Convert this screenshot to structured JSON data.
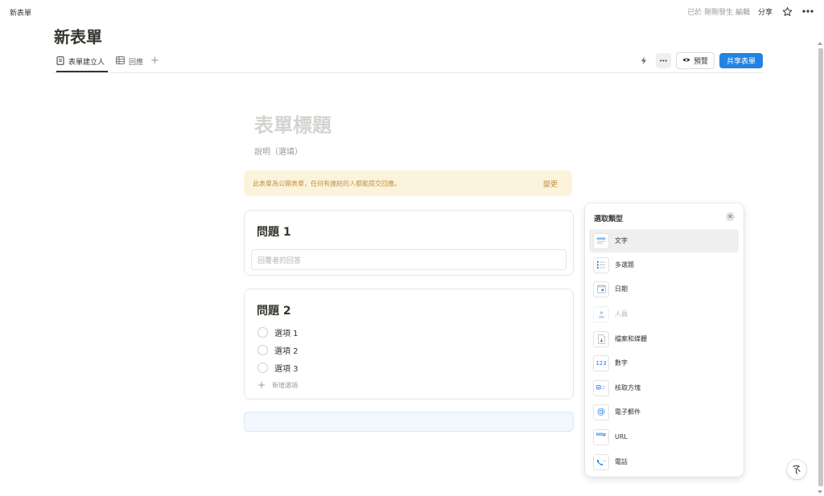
{
  "breadcrumb": "新表單",
  "topbar": {
    "edited": "已於 剛剛發生 編輯",
    "share": "分享"
  },
  "page_title": "新表單",
  "tabs": [
    {
      "label": "表單建立人",
      "icon": "form-icon"
    },
    {
      "label": "回應",
      "icon": "table-icon"
    }
  ],
  "toolbar": {
    "preview": "預覽",
    "share_form": "共享表單"
  },
  "form": {
    "title_placeholder": "表單標題",
    "desc_placeholder": "說明（選填）",
    "notice": "此表單為公開表單，任何有連結的人都能提交回應。",
    "notice_action": "變更",
    "questions": [
      {
        "title": "問題 1",
        "answer_placeholder": "回覆者的回答"
      },
      {
        "title": "問題 2",
        "options": [
          "選項 1",
          "選項 2",
          "選項 3"
        ],
        "add_option": "新增選項"
      }
    ]
  },
  "type_panel": {
    "title": "選取類型",
    "items": [
      {
        "label": "文字",
        "icon": "text-type-icon",
        "selected": true
      },
      {
        "label": "多選題",
        "icon": "multi-select-icon"
      },
      {
        "label": "日期",
        "icon": "date-icon"
      },
      {
        "label": "人員",
        "icon": "person-icon",
        "disabled": true
      },
      {
        "label": "檔案和媒體",
        "icon": "file-icon"
      },
      {
        "label": "數字",
        "icon": "number-icon",
        "glyph": "123"
      },
      {
        "label": "核取方塊",
        "icon": "checkbox-icon"
      },
      {
        "label": "電子郵件",
        "icon": "email-icon",
        "glyph": "@"
      },
      {
        "label": "URL",
        "icon": "url-icon",
        "glyph": "http"
      },
      {
        "label": "電話",
        "icon": "phone-icon"
      }
    ]
  },
  "colors": {
    "accent": "#2383e2",
    "notice_bg": "#fbf3db",
    "notice_text": "#c29343"
  }
}
